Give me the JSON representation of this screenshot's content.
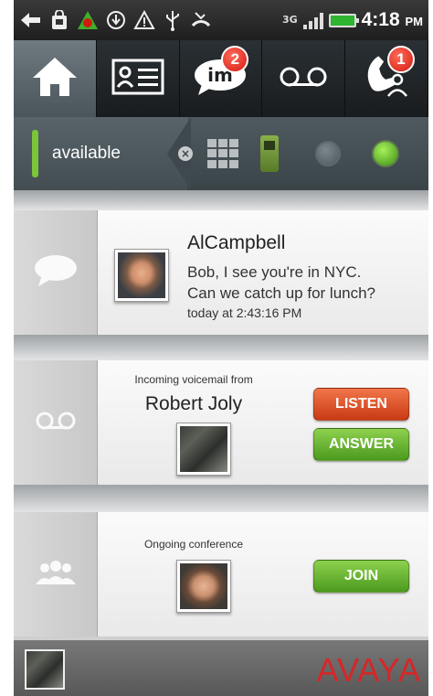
{
  "statusbar": {
    "icons": [
      "back-arrow-icon",
      "shopping-bag-icon",
      "avaya-triangle-icon",
      "download-icon",
      "warning-icon",
      "usb-icon",
      "missed-call-icon"
    ],
    "network": "3G",
    "time": "4:18",
    "ampm": "PM"
  },
  "nav": {
    "tabs": [
      {
        "name": "home",
        "active": true
      },
      {
        "name": "contacts"
      },
      {
        "name": "im",
        "label": "im",
        "badge": "2"
      },
      {
        "name": "voicemail"
      },
      {
        "name": "conference",
        "badge": "1"
      }
    ]
  },
  "availability": {
    "status": "available",
    "accent": "#7cc43a"
  },
  "message_card": {
    "sender": "AlCampbell",
    "text_line1": "Bob, I see you're in NYC.",
    "text_line2": "Can we catch up for lunch?",
    "time": "today at 2:43:16 PM"
  },
  "voicemail_card": {
    "caption": "Incoming voicemail from",
    "name": "Robert Joly",
    "listen_label": "LISTEN",
    "answer_label": "ANSWER"
  },
  "conference_card": {
    "caption": "Ongoing conference",
    "join_label": "JOIN"
  },
  "brand": {
    "logo": "AVAYA",
    "color": "#d62628"
  }
}
